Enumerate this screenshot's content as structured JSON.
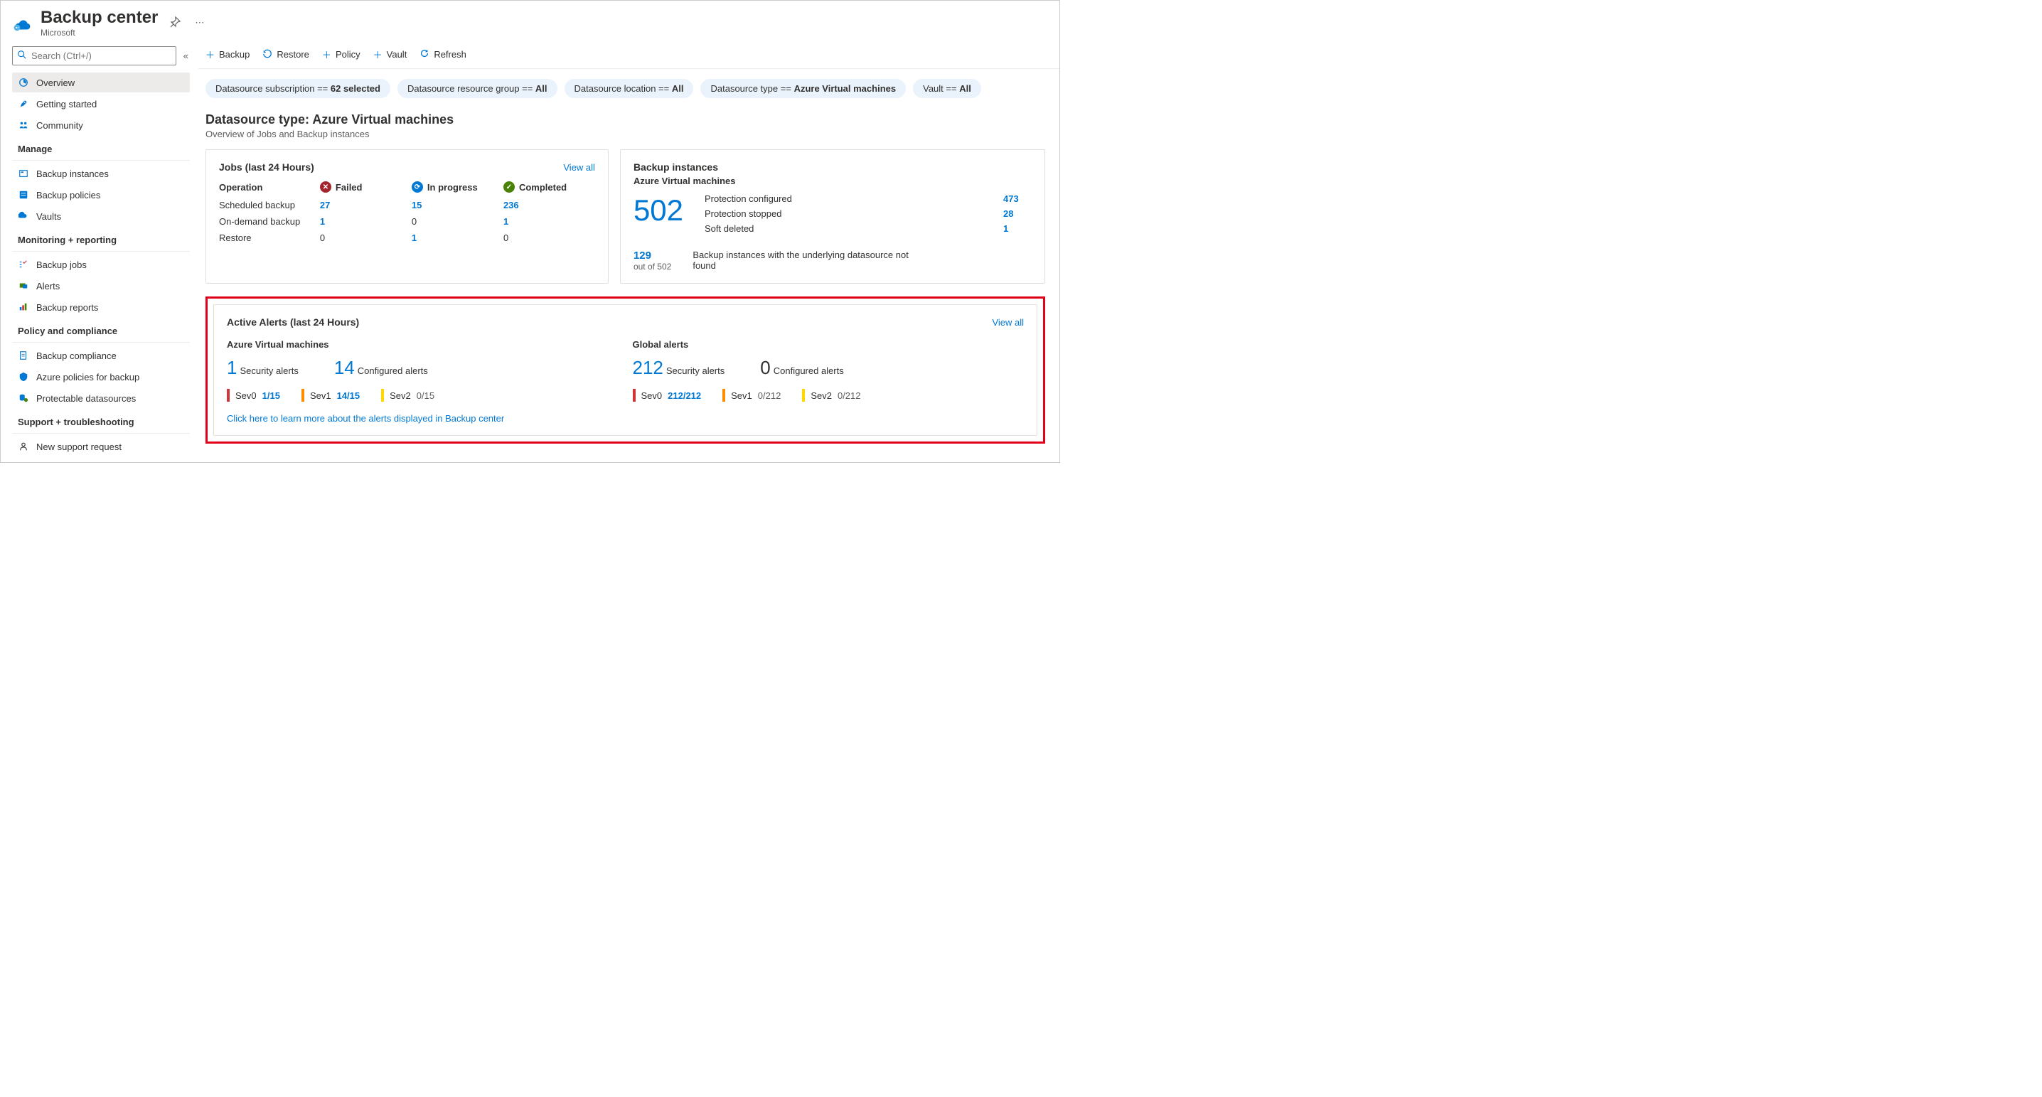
{
  "header": {
    "title": "Backup center",
    "subtitle": "Microsoft"
  },
  "search": {
    "placeholder": "Search (Ctrl+/)"
  },
  "nav": {
    "top": [
      {
        "label": "Overview"
      },
      {
        "label": "Getting started"
      },
      {
        "label": "Community"
      }
    ],
    "sections": [
      {
        "title": "Manage",
        "items": [
          "Backup instances",
          "Backup policies",
          "Vaults"
        ]
      },
      {
        "title": "Monitoring + reporting",
        "items": [
          "Backup jobs",
          "Alerts",
          "Backup reports"
        ]
      },
      {
        "title": "Policy and compliance",
        "items": [
          "Backup compliance",
          "Azure policies for backup",
          "Protectable datasources"
        ]
      },
      {
        "title": "Support + troubleshooting",
        "items": [
          "New support request"
        ]
      }
    ]
  },
  "toolbar": {
    "backup": "Backup",
    "restore": "Restore",
    "policy": "Policy",
    "vault": "Vault",
    "refresh": "Refresh"
  },
  "filters": [
    {
      "label": "Datasource subscription == ",
      "value": "62 selected"
    },
    {
      "label": "Datasource resource group == ",
      "value": "All"
    },
    {
      "label": "Datasource location == ",
      "value": "All"
    },
    {
      "label": "Datasource type == ",
      "value": "Azure Virtual machines"
    },
    {
      "label": "Vault == ",
      "value": "All"
    }
  ],
  "section": {
    "title": "Datasource type: Azure Virtual machines",
    "sub": "Overview of Jobs and Backup instances"
  },
  "jobs": {
    "title": "Jobs (last 24 Hours)",
    "view_all": "View all",
    "cols": {
      "op": "Operation",
      "failed": "Failed",
      "inprog": "In progress",
      "comp": "Completed"
    },
    "rows": [
      {
        "op": "Scheduled backup",
        "failed": "27",
        "inprog": "15",
        "comp": "236"
      },
      {
        "op": "On-demand backup",
        "failed": "1",
        "inprog": "0",
        "comp": "1"
      },
      {
        "op": "Restore",
        "failed": "0",
        "inprog": "1",
        "comp": "0"
      }
    ]
  },
  "instances": {
    "title": "Backup instances",
    "subtitle": "Azure Virtual machines",
    "total": "502",
    "lines": [
      {
        "k": "Protection configured",
        "v": "473"
      },
      {
        "k": "Protection stopped",
        "v": "28"
      },
      {
        "k": "Soft deleted",
        "v": "1"
      }
    ],
    "footer": {
      "num": "129",
      "sub": "out of 502",
      "desc": "Backup instances with the underlying datasource not found"
    }
  },
  "alerts": {
    "title": "Active Alerts (last 24 Hours)",
    "view_all": "View all",
    "col1": {
      "title": "Azure Virtual machines",
      "security_count": "1",
      "security_label": "Security alerts",
      "config_count": "14",
      "config_label": "Configured alerts",
      "sev": [
        {
          "label": "Sev0",
          "val": "1/15",
          "link": true
        },
        {
          "label": "Sev1",
          "val": "14/15",
          "link": true
        },
        {
          "label": "Sev2",
          "val": "0/15",
          "link": false
        }
      ]
    },
    "col2": {
      "title": "Global alerts",
      "security_count": "212",
      "security_label": "Security alerts",
      "config_count": "0",
      "config_label": "Configured alerts",
      "sev": [
        {
          "label": "Sev0",
          "val": "212/212",
          "link": true
        },
        {
          "label": "Sev1",
          "val": "0/212",
          "link": false
        },
        {
          "label": "Sev2",
          "val": "0/212",
          "link": false
        }
      ]
    },
    "learn": "Click here to learn more about the alerts displayed in Backup center"
  }
}
